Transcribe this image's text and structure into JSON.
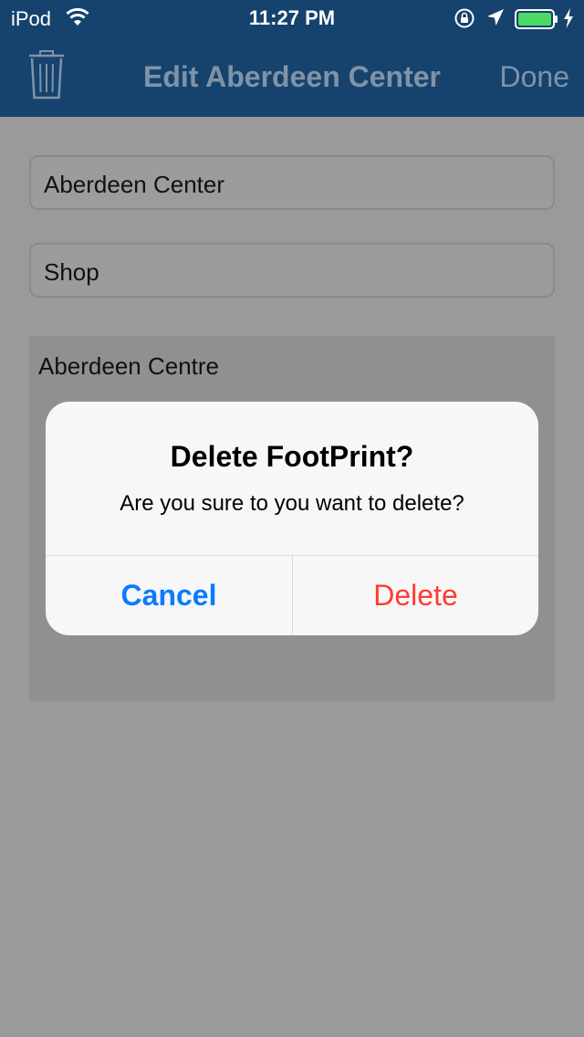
{
  "status_bar": {
    "carrier": "iPod",
    "time": "11:27 PM",
    "icons": [
      "wifi-icon",
      "rotation-lock-icon",
      "location-arrow-icon",
      "battery-icon",
      "charging-bolt-icon"
    ]
  },
  "nav": {
    "title": "Edit Aberdeen Center",
    "done_label": "Done",
    "left_icon": "trash-icon"
  },
  "form": {
    "name_value": "Aberdeen Center",
    "type_value": "Shop",
    "map_label": "Aberdeen Centre"
  },
  "alert": {
    "title": "Delete FootPrint?",
    "message": "Are you sure to you want to delete?",
    "cancel_label": "Cancel",
    "delete_label": "Delete"
  },
  "colors": {
    "nav_background": "#16436d",
    "dim_background": "#9a9a9a",
    "cancel_blue": "#0a7bff",
    "delete_red": "#ff3b30",
    "battery_green": "#4cd964"
  }
}
